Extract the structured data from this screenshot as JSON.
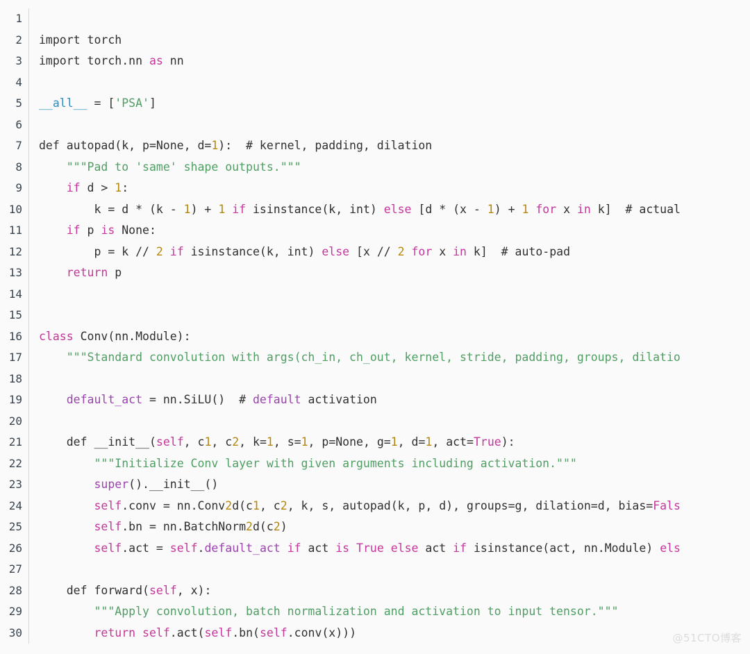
{
  "editor": {
    "background_color": "#fafafa",
    "gutter_divider_color": "#d7d7d7",
    "line_number_color": "#39444f",
    "default_text_color": "#2f2f2f",
    "keyword_color": "#c4369b",
    "string_color": "#4f9e63",
    "number_color": "#b5860c",
    "attribute_color": "#9c41b0",
    "dunder_color": "#2a8fc4",
    "comment_color": "#33383d",
    "language": "python",
    "first_line_number": 1,
    "last_line_number": 30,
    "total_lines": 30
  },
  "watermark": {
    "text": "@51CTO博客",
    "color": "#dcdcdc"
  },
  "lines": [
    {
      "n": "1",
      "tokens": []
    },
    {
      "n": "2",
      "tokens": [
        {
          "t": "import torch",
          "c": "t-def"
        }
      ]
    },
    {
      "n": "3",
      "tokens": [
        {
          "t": "import torch.nn ",
          "c": "t-def"
        },
        {
          "t": "as",
          "c": "t-kw"
        },
        {
          "t": " nn",
          "c": "t-def"
        }
      ]
    },
    {
      "n": "4",
      "tokens": []
    },
    {
      "n": "5",
      "tokens": [
        {
          "t": "__all__",
          "c": "t-dunder"
        },
        {
          "t": " = [",
          "c": "t-def"
        },
        {
          "t": "'PSA'",
          "c": "t-str"
        },
        {
          "t": "]",
          "c": "t-def"
        }
      ]
    },
    {
      "n": "6",
      "tokens": []
    },
    {
      "n": "7",
      "tokens": [
        {
          "t": "def autopad(k, p=None, d=",
          "c": "t-def"
        },
        {
          "t": "1",
          "c": "t-num"
        },
        {
          "t": "):  # kernel, padding, dilation",
          "c": "t-def"
        }
      ]
    },
    {
      "n": "8",
      "tokens": [
        {
          "t": "    ",
          "c": "t-def"
        },
        {
          "t": "\"\"\"Pad to 'same' shape outputs.\"\"\"",
          "c": "t-str"
        }
      ]
    },
    {
      "n": "9",
      "tokens": [
        {
          "t": "    ",
          "c": "t-def"
        },
        {
          "t": "if",
          "c": "t-kw"
        },
        {
          "t": " d > ",
          "c": "t-def"
        },
        {
          "t": "1",
          "c": "t-num"
        },
        {
          "t": ":",
          "c": "t-def"
        }
      ]
    },
    {
      "n": "10",
      "tokens": [
        {
          "t": "        k = d * (k - ",
          "c": "t-def"
        },
        {
          "t": "1",
          "c": "t-num"
        },
        {
          "t": ") + ",
          "c": "t-def"
        },
        {
          "t": "1",
          "c": "t-num"
        },
        {
          "t": " ",
          "c": "t-def"
        },
        {
          "t": "if",
          "c": "t-kw"
        },
        {
          "t": " isinstance(k, int) ",
          "c": "t-def"
        },
        {
          "t": "else",
          "c": "t-kw"
        },
        {
          "t": " [d * (x - ",
          "c": "t-def"
        },
        {
          "t": "1",
          "c": "t-num"
        },
        {
          "t": ") + ",
          "c": "t-def"
        },
        {
          "t": "1",
          "c": "t-num"
        },
        {
          "t": " ",
          "c": "t-def"
        },
        {
          "t": "for",
          "c": "t-kw"
        },
        {
          "t": " x ",
          "c": "t-def"
        },
        {
          "t": "in",
          "c": "t-kw"
        },
        {
          "t": " k]  # actual",
          "c": "t-def"
        }
      ]
    },
    {
      "n": "11",
      "tokens": [
        {
          "t": "    ",
          "c": "t-def"
        },
        {
          "t": "if",
          "c": "t-kw"
        },
        {
          "t": " p ",
          "c": "t-def"
        },
        {
          "t": "is",
          "c": "t-kw"
        },
        {
          "t": " None:",
          "c": "t-def"
        }
      ]
    },
    {
      "n": "12",
      "tokens": [
        {
          "t": "        p = k // ",
          "c": "t-def"
        },
        {
          "t": "2",
          "c": "t-num"
        },
        {
          "t": " ",
          "c": "t-def"
        },
        {
          "t": "if",
          "c": "t-kw"
        },
        {
          "t": " isinstance(k, int) ",
          "c": "t-def"
        },
        {
          "t": "else",
          "c": "t-kw"
        },
        {
          "t": " [x // ",
          "c": "t-def"
        },
        {
          "t": "2",
          "c": "t-num"
        },
        {
          "t": " ",
          "c": "t-def"
        },
        {
          "t": "for",
          "c": "t-kw"
        },
        {
          "t": " x ",
          "c": "t-def"
        },
        {
          "t": "in",
          "c": "t-kw"
        },
        {
          "t": " k]  # auto-pad",
          "c": "t-def"
        }
      ]
    },
    {
      "n": "13",
      "tokens": [
        {
          "t": "    ",
          "c": "t-def"
        },
        {
          "t": "return",
          "c": "t-kw"
        },
        {
          "t": " p",
          "c": "t-def"
        }
      ]
    },
    {
      "n": "14",
      "tokens": []
    },
    {
      "n": "15",
      "tokens": []
    },
    {
      "n": "16",
      "tokens": [
        {
          "t": "class",
          "c": "t-kw"
        },
        {
          "t": " Conv(nn.Module):",
          "c": "t-def"
        }
      ]
    },
    {
      "n": "17",
      "tokens": [
        {
          "t": "    ",
          "c": "t-def"
        },
        {
          "t": "\"\"\"Standard convolution with args(ch_in, ch_out, kernel, stride, padding, groups, dilatio",
          "c": "t-str"
        }
      ]
    },
    {
      "n": "18",
      "tokens": []
    },
    {
      "n": "19",
      "tokens": [
        {
          "t": "    ",
          "c": "t-def"
        },
        {
          "t": "default_act",
          "c": "t-attr"
        },
        {
          "t": " = nn.SiLU()  # ",
          "c": "t-def"
        },
        {
          "t": "default",
          "c": "t-attr"
        },
        {
          "t": " activation",
          "c": "t-def"
        }
      ]
    },
    {
      "n": "20",
      "tokens": []
    },
    {
      "n": "21",
      "tokens": [
        {
          "t": "    def __init__(",
          "c": "t-def"
        },
        {
          "t": "self",
          "c": "t-self"
        },
        {
          "t": ", c",
          "c": "t-def"
        },
        {
          "t": "1",
          "c": "t-num"
        },
        {
          "t": ", c",
          "c": "t-def"
        },
        {
          "t": "2",
          "c": "t-num"
        },
        {
          "t": ", k=",
          "c": "t-def"
        },
        {
          "t": "1",
          "c": "t-num"
        },
        {
          "t": ", s=",
          "c": "t-def"
        },
        {
          "t": "1",
          "c": "t-num"
        },
        {
          "t": ", p=None, g=",
          "c": "t-def"
        },
        {
          "t": "1",
          "c": "t-num"
        },
        {
          "t": ", d=",
          "c": "t-def"
        },
        {
          "t": "1",
          "c": "t-num"
        },
        {
          "t": ", act=",
          "c": "t-def"
        },
        {
          "t": "True",
          "c": "t-kw"
        },
        {
          "t": "):",
          "c": "t-def"
        }
      ]
    },
    {
      "n": "22",
      "tokens": [
        {
          "t": "        ",
          "c": "t-def"
        },
        {
          "t": "\"\"\"Initialize Conv layer with given arguments including activation.\"\"\"",
          "c": "t-str"
        }
      ]
    },
    {
      "n": "23",
      "tokens": [
        {
          "t": "        ",
          "c": "t-def"
        },
        {
          "t": "super",
          "c": "t-attr"
        },
        {
          "t": "().__init__()",
          "c": "t-def"
        }
      ]
    },
    {
      "n": "24",
      "tokens": [
        {
          "t": "        ",
          "c": "t-def"
        },
        {
          "t": "self",
          "c": "t-self"
        },
        {
          "t": ".conv = nn.Conv",
          "c": "t-def"
        },
        {
          "t": "2",
          "c": "t-num"
        },
        {
          "t": "d(c",
          "c": "t-def"
        },
        {
          "t": "1",
          "c": "t-num"
        },
        {
          "t": ", c",
          "c": "t-def"
        },
        {
          "t": "2",
          "c": "t-num"
        },
        {
          "t": ", k, s, autopad(k, p, d), groups=g, dilation=d, bias=",
          "c": "t-def"
        },
        {
          "t": "Fals",
          "c": "t-kw"
        }
      ]
    },
    {
      "n": "25",
      "tokens": [
        {
          "t": "        ",
          "c": "t-def"
        },
        {
          "t": "self",
          "c": "t-self"
        },
        {
          "t": ".bn = nn.BatchNorm",
          "c": "t-def"
        },
        {
          "t": "2",
          "c": "t-num"
        },
        {
          "t": "d(c",
          "c": "t-def"
        },
        {
          "t": "2",
          "c": "t-num"
        },
        {
          "t": ")",
          "c": "t-def"
        }
      ]
    },
    {
      "n": "26",
      "tokens": [
        {
          "t": "        ",
          "c": "t-def"
        },
        {
          "t": "self",
          "c": "t-self"
        },
        {
          "t": ".act = ",
          "c": "t-def"
        },
        {
          "t": "self",
          "c": "t-self"
        },
        {
          "t": ".",
          "c": "t-def"
        },
        {
          "t": "default_act",
          "c": "t-attr"
        },
        {
          "t": " ",
          "c": "t-def"
        },
        {
          "t": "if",
          "c": "t-kw"
        },
        {
          "t": " act ",
          "c": "t-def"
        },
        {
          "t": "is",
          "c": "t-kw"
        },
        {
          "t": " ",
          "c": "t-def"
        },
        {
          "t": "True",
          "c": "t-kw"
        },
        {
          "t": " ",
          "c": "t-def"
        },
        {
          "t": "else",
          "c": "t-kw"
        },
        {
          "t": " act ",
          "c": "t-def"
        },
        {
          "t": "if",
          "c": "t-kw"
        },
        {
          "t": " isinstance(act, nn.Module) ",
          "c": "t-def"
        },
        {
          "t": "els",
          "c": "t-kw"
        }
      ]
    },
    {
      "n": "27",
      "tokens": []
    },
    {
      "n": "28",
      "tokens": [
        {
          "t": "    def forward(",
          "c": "t-def"
        },
        {
          "t": "self",
          "c": "t-self"
        },
        {
          "t": ", x):",
          "c": "t-def"
        }
      ]
    },
    {
      "n": "29",
      "tokens": [
        {
          "t": "        ",
          "c": "t-def"
        },
        {
          "t": "\"\"\"Apply convolution, batch normalization and activation to input tensor.\"\"\"",
          "c": "t-str"
        }
      ]
    },
    {
      "n": "30",
      "tokens": [
        {
          "t": "        ",
          "c": "t-def"
        },
        {
          "t": "return",
          "c": "t-kw"
        },
        {
          "t": " ",
          "c": "t-def"
        },
        {
          "t": "self",
          "c": "t-self"
        },
        {
          "t": ".act(",
          "c": "t-def"
        },
        {
          "t": "self",
          "c": "t-self"
        },
        {
          "t": ".bn(",
          "c": "t-def"
        },
        {
          "t": "self",
          "c": "t-self"
        },
        {
          "t": ".conv(x)))",
          "c": "t-def"
        }
      ]
    }
  ]
}
